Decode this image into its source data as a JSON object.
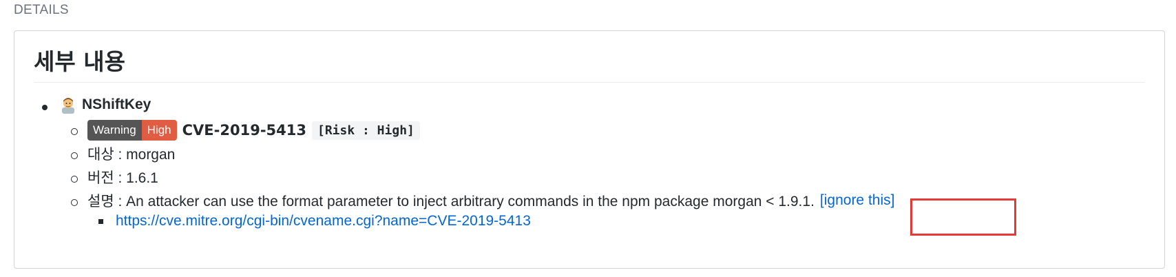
{
  "section_label": "DETAILS",
  "heading": "세부 내용",
  "author": {
    "name": "NShiftKey",
    "avatar_icon": "person-avatar-icon"
  },
  "vulnerability": {
    "badge_left": "Warning",
    "badge_right": "High",
    "cve_id": "CVE-2019-5413",
    "risk": "[Risk : High]",
    "target_label": "대상 : morgan",
    "version_label": "버전 : 1.6.1",
    "description_label": "설명 : An attacker can use the format parameter to inject arbitrary commands in the npm package morgan < 1.9.1.",
    "ignore_link": "[ignore this]",
    "reference_link": "https://cve.mitre.org/cgi-bin/cvename.cgi?name=CVE-2019-5413"
  },
  "colors": {
    "link": "#0366d6",
    "badge_dark": "#555555",
    "badge_red": "#e05d44",
    "highlight": "#e53935"
  }
}
